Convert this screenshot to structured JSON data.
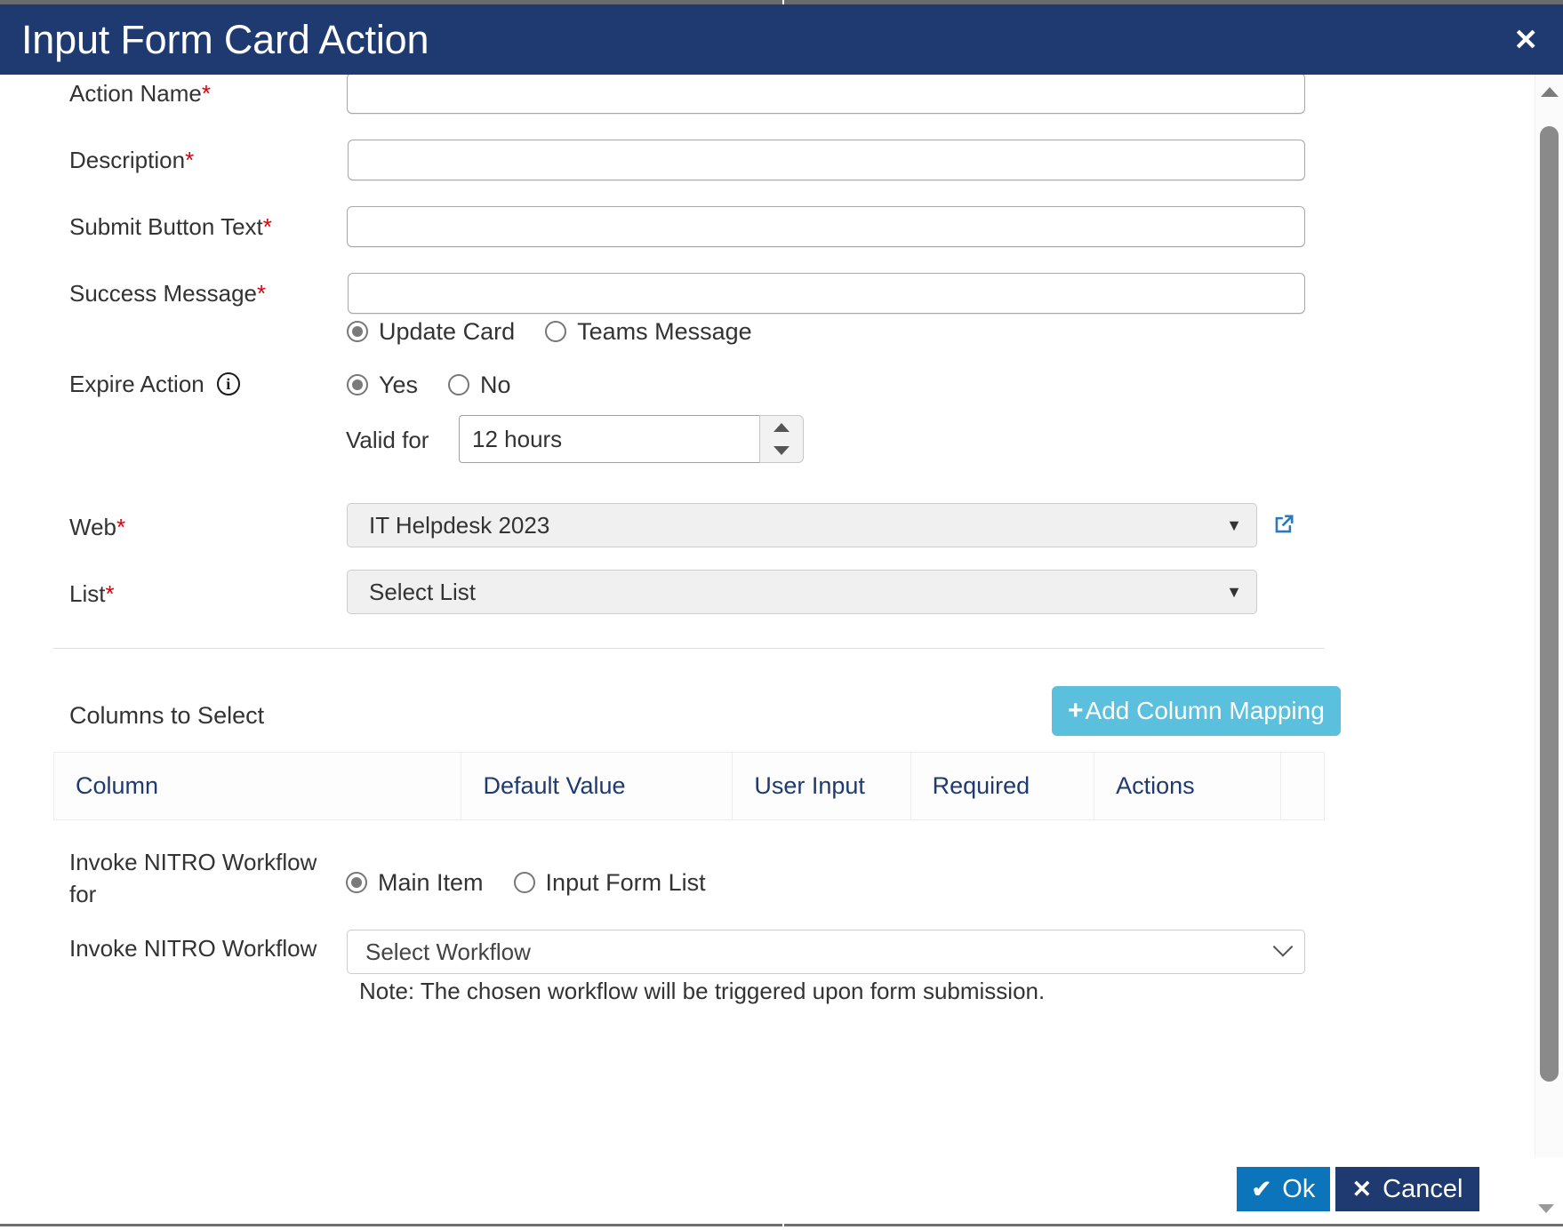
{
  "dialog": {
    "title": "Input Form Card Action",
    "close_label": "✕"
  },
  "fields": {
    "action_name": {
      "label": "Action Name",
      "required_marker": "*",
      "value": "",
      "placeholder": ""
    },
    "description": {
      "label": "Description",
      "required_marker": "*",
      "value": "",
      "placeholder": ""
    },
    "submit_button_text": {
      "label": "Submit Button Text",
      "required_marker": "*",
      "value": "",
      "placeholder": ""
    },
    "success_message": {
      "label": "Success Message",
      "required_marker": "*",
      "value": "",
      "placeholder": ""
    },
    "expire_action": {
      "label": "Expire Action",
      "info_glyph": "i"
    },
    "valid_for": {
      "label": "Valid for",
      "value": "12 hours"
    },
    "web": {
      "label": "Web",
      "required_marker": "*",
      "value": "IT Helpdesk 2023",
      "caret": "▼"
    },
    "list": {
      "label": "List",
      "required_marker": "*",
      "value": "Select List",
      "caret": "▼"
    },
    "invoke_for": {
      "label": "Invoke NITRO Workflow for"
    },
    "invoke_workflow": {
      "label": "Invoke NITRO Workflow",
      "value": "Select Workflow"
    }
  },
  "radios": {
    "success_message_mode": [
      {
        "label": "Update Card",
        "checked": true
      },
      {
        "label": "Teams Message",
        "checked": false
      }
    ],
    "expire_action": [
      {
        "label": "Yes",
        "checked": true
      },
      {
        "label": "No",
        "checked": false
      }
    ],
    "invoke_for": [
      {
        "label": "Main Item",
        "checked": true
      },
      {
        "label": "Input Form List",
        "checked": false
      }
    ]
  },
  "columns_section": {
    "heading": "Columns to Select",
    "add_button_label": "Add Column Mapping",
    "add_button_plus": "+",
    "table": {
      "headers": [
        "Column",
        "Default Value",
        "User Input",
        "Required",
        "Actions",
        ""
      ],
      "rows": []
    }
  },
  "note": "Note: The chosen workflow will be triggered upon form submission.",
  "footer": {
    "ok_label": "Ok",
    "ok_glyph": "✔",
    "cancel_label": "Cancel",
    "cancel_glyph": "✕"
  },
  "colors": {
    "titlebar": "#1f3a70",
    "accent_add": "#5bc0de",
    "ok": "#0b74bb",
    "cancel": "#1f3a70",
    "required": "#d8000c",
    "table_header_text": "#1f3a70",
    "ext_link": "#2a7ab9"
  }
}
